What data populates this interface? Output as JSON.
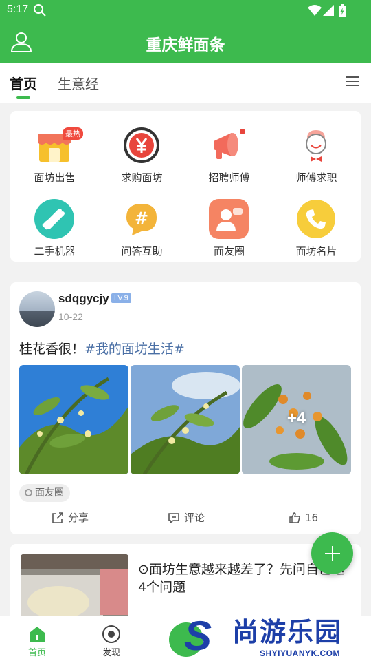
{
  "status_bar": {
    "time": "5:17"
  },
  "header": {
    "title": "重庆鲜面条"
  },
  "tabs": [
    {
      "label": "首页"
    },
    {
      "label": "生意经"
    }
  ],
  "services": [
    {
      "label": "面坊出售",
      "icon": "storefront-icon",
      "badge": "最热"
    },
    {
      "label": "求购面坊",
      "icon": "yen-icon"
    },
    {
      "label": "招聘师傅",
      "icon": "megaphone-icon"
    },
    {
      "label": "师傅求职",
      "icon": "chef-icon"
    },
    {
      "label": "二手机器",
      "icon": "tools-icon"
    },
    {
      "label": "问答互助",
      "icon": "hashtag-chat-icon"
    },
    {
      "label": "面友圈",
      "icon": "people-chat-icon"
    },
    {
      "label": "面坊名片",
      "icon": "phone-icon"
    }
  ],
  "post": {
    "username": "sdqgycjy",
    "level": "LV.9",
    "date": "10-22",
    "text": "桂花香很！",
    "topic": "#我的面坊生活#",
    "more_photos": "+4",
    "tag": "面友圈",
    "actions": {
      "share": "分享",
      "comment": "评论",
      "likes": "16"
    }
  },
  "article": {
    "title": "⊙面坊生意越来越差了？先问自己这4个问题"
  },
  "bottom_nav": [
    {
      "label": "首页"
    },
    {
      "label": "发现"
    }
  ],
  "watermark": {
    "brand": "尚游乐园",
    "url": "SHYIYUANYK.COM"
  },
  "colors": {
    "primary": "#3dba4e",
    "topic": "#4a6fa5",
    "hot_badge": "#f04a3e",
    "level_badge": "#8ab0e8"
  }
}
